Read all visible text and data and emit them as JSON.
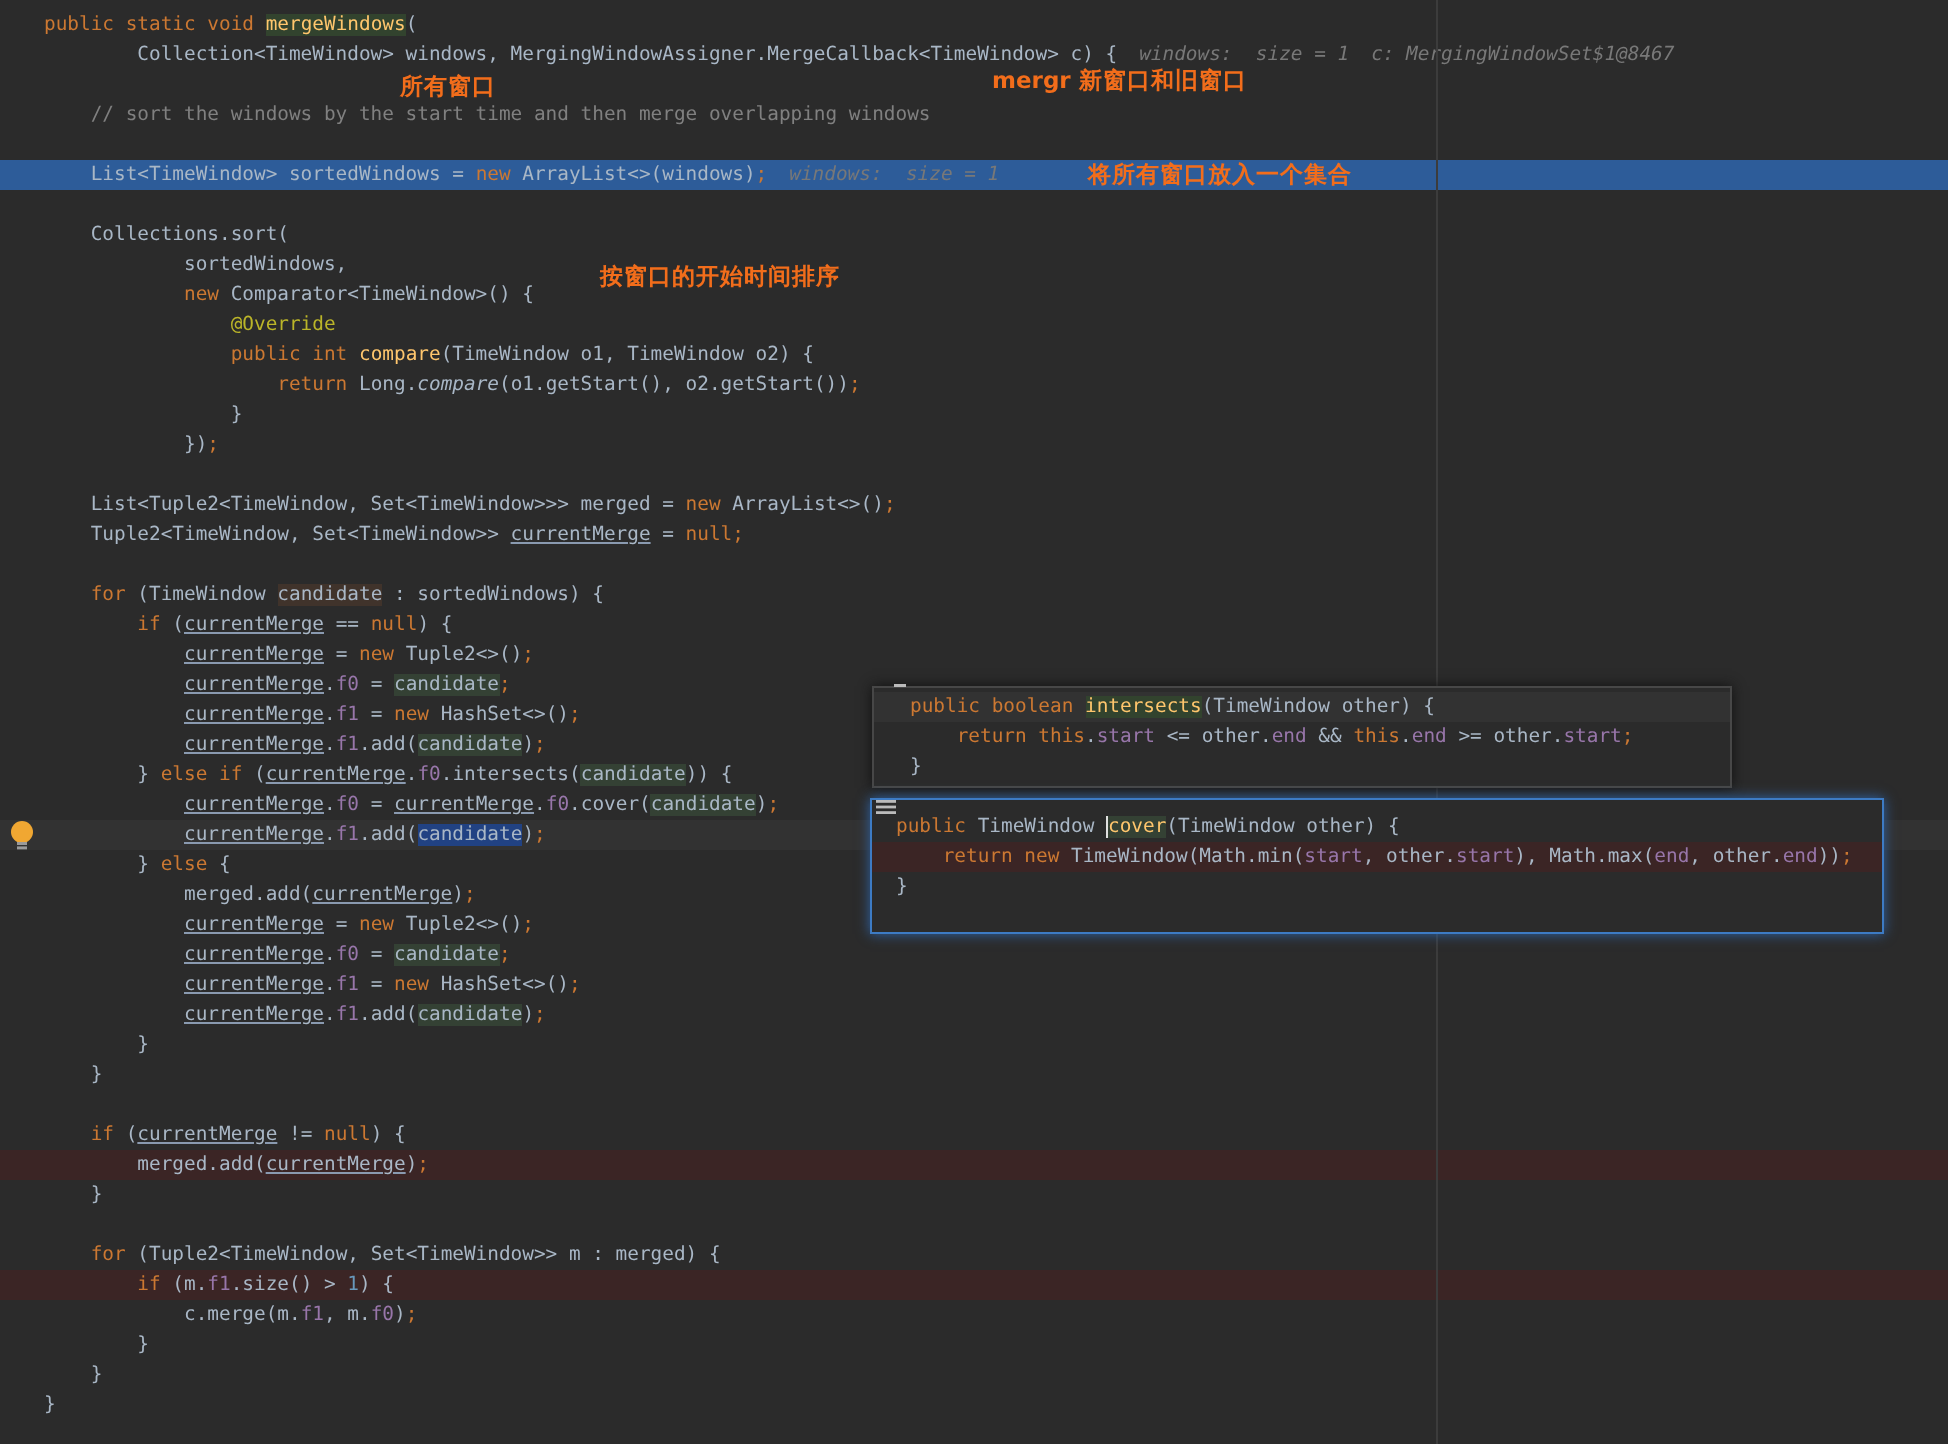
{
  "editor": {
    "lines": [
      {
        "kind": "code",
        "tokens": [
          {
            "text": "public static void ",
            "kind": "keyword"
          },
          {
            "text": "mergeWindows",
            "kind": "markedmethod"
          },
          {
            "text": "(",
            "kind": "plain"
          }
        ]
      },
      {
        "kind": "code",
        "tokens": [
          {
            "text": "        Collection<TimeWindow> windows, MergingWindowAssigner.MergeCallback<TimeWindow> c) {",
            "kind": "plain"
          },
          {
            "text": "windows:  size = 1",
            "kind": "hint"
          },
          {
            "text": "c: MergingWindowSet$1@8467",
            "kind": "hint"
          }
        ]
      },
      {
        "kind": "blank"
      },
      {
        "kind": "code",
        "tokens": [
          {
            "text": "    // sort the windows by the start time and then merge overlapping windows",
            "kind": "comment"
          }
        ]
      },
      {
        "kind": "blank"
      },
      {
        "kind": "execution",
        "tokens": [
          {
            "text": "    List<TimeWindow> sortedWindows = ",
            "kind": "plain"
          },
          {
            "text": "new",
            "kind": "keyword"
          },
          {
            "text": " ArrayList<>(windows)",
            "kind": "plain"
          },
          {
            "text": ";",
            "kind": "keyword"
          },
          {
            "text": "windows:  size = 1",
            "kind": "hint"
          }
        ]
      },
      {
        "kind": "blank"
      },
      {
        "kind": "code",
        "tokens": [
          {
            "text": "    Collections.sort(",
            "kind": "plain"
          }
        ]
      },
      {
        "kind": "code",
        "tokens": [
          {
            "text": "            sortedWindows,",
            "kind": "plain"
          }
        ]
      },
      {
        "kind": "code",
        "tokens": [
          {
            "text": "            new",
            "kind": "keyword"
          },
          {
            "text": " Comparator<TimeWindow>() {",
            "kind": "plain"
          }
        ]
      },
      {
        "kind": "code",
        "tokens": [
          {
            "text": "                @Override",
            "kind": "annotation"
          }
        ]
      },
      {
        "kind": "code",
        "tokens": [
          {
            "text": "                public int ",
            "kind": "keyword"
          },
          {
            "text": "compare",
            "kind": "method"
          },
          {
            "text": "(TimeWindow o1, TimeWindow o2) {",
            "kind": "plain"
          }
        ]
      },
      {
        "kind": "code",
        "tokens": [
          {
            "text": "                    return ",
            "kind": "keyword"
          },
          {
            "text": "Long.",
            "kind": "plain"
          },
          {
            "text": "compare",
            "kind": "italic"
          },
          {
            "text": "(o1.getStart(), o2.getStart())",
            "kind": "plain"
          },
          {
            "text": ";",
            "kind": "keyword"
          }
        ]
      },
      {
        "kind": "code",
        "tokens": [
          {
            "text": "                }",
            "kind": "plain"
          }
        ]
      },
      {
        "kind": "code",
        "tokens": [
          {
            "text": "            })",
            "kind": "plain"
          },
          {
            "text": ";",
            "kind": "keyword"
          }
        ]
      },
      {
        "kind": "blank"
      },
      {
        "kind": "code",
        "tokens": [
          {
            "text": "    List<Tuple2<TimeWindow, Set<TimeWindow>>> merged = ",
            "kind": "plain"
          },
          {
            "text": "new",
            "kind": "keyword"
          },
          {
            "text": " ArrayList<>()",
            "kind": "plain"
          },
          {
            "text": ";",
            "kind": "keyword"
          }
        ]
      },
      {
        "kind": "code",
        "tokens": [
          {
            "text": "    Tuple2<TimeWindow, Set<TimeWindow>> ",
            "kind": "plain"
          },
          {
            "text": "currentMerge",
            "kind": "variable"
          },
          {
            "text": " = ",
            "kind": "plain"
          },
          {
            "text": "null;",
            "kind": "keyword"
          }
        ]
      },
      {
        "kind": "blank"
      },
      {
        "kind": "code",
        "tokens": [
          {
            "text": "    for ",
            "kind": "keyword"
          },
          {
            "text": "(TimeWindow ",
            "kind": "plain"
          },
          {
            "text": "candidate",
            "kind": "writeref"
          },
          {
            "text": " : sortedWindows) {",
            "kind": "plain"
          }
        ]
      },
      {
        "kind": "code",
        "tokens": [
          {
            "text": "        if ",
            "kind": "keyword"
          },
          {
            "text": "(",
            "kind": "plain"
          },
          {
            "text": "currentMerge",
            "kind": "variable"
          },
          {
            "text": " == ",
            "kind": "plain"
          },
          {
            "text": "null",
            "kind": "keyword"
          },
          {
            "text": ") {",
            "kind": "plain"
          }
        ]
      },
      {
        "kind": "code",
        "tokens": [
          {
            "text": "            currentMerge",
            "kind": "variable"
          },
          {
            "text": " = ",
            "kind": "plain"
          },
          {
            "text": "new",
            "kind": "keyword"
          },
          {
            "text": " Tuple2<>()",
            "kind": "plain"
          },
          {
            "text": ";",
            "kind": "keyword"
          }
        ]
      },
      {
        "kind": "code",
        "tokens": [
          {
            "text": "            currentMerge",
            "kind": "variable"
          },
          {
            "text": ".",
            "kind": "plain"
          },
          {
            "text": "f0",
            "kind": "field"
          },
          {
            "text": " = ",
            "kind": "plain"
          },
          {
            "text": "candidate",
            "kind": "readref"
          },
          {
            "text": ";",
            "kind": "keyword"
          }
        ]
      },
      {
        "kind": "code",
        "tokens": [
          {
            "text": "            currentMerge",
            "kind": "variable"
          },
          {
            "text": ".",
            "kind": "plain"
          },
          {
            "text": "f1",
            "kind": "field"
          },
          {
            "text": " = ",
            "kind": "plain"
          },
          {
            "text": "new",
            "kind": "keyword"
          },
          {
            "text": " HashSet<>()",
            "kind": "plain"
          },
          {
            "text": ";",
            "kind": "keyword"
          }
        ]
      },
      {
        "kind": "code",
        "tokens": [
          {
            "text": "            currentMerge",
            "kind": "variable"
          },
          {
            "text": ".",
            "kind": "plain"
          },
          {
            "text": "f1",
            "kind": "field"
          },
          {
            "text": ".add(",
            "kind": "plain"
          },
          {
            "text": "candidate",
            "kind": "readref"
          },
          {
            "text": ")",
            "kind": "plain"
          },
          {
            "text": ";",
            "kind": "keyword"
          }
        ]
      },
      {
        "kind": "code",
        "tokens": [
          {
            "text": "        } ",
            "kind": "plain"
          },
          {
            "text": "else if ",
            "kind": "keyword"
          },
          {
            "text": "(",
            "kind": "plain"
          },
          {
            "text": "currentMerge",
            "kind": "variable"
          },
          {
            "text": ".",
            "kind": "plain"
          },
          {
            "text": "f0",
            "kind": "field"
          },
          {
            "text": ".intersects(",
            "kind": "plain"
          },
          {
            "text": "candidate",
            "kind": "readref"
          },
          {
            "text": ")) {",
            "kind": "plain"
          }
        ]
      },
      {
        "kind": "code",
        "tokens": [
          {
            "text": "            currentMerge",
            "kind": "variable"
          },
          {
            "text": ".",
            "kind": "plain"
          },
          {
            "text": "f0",
            "kind": "field"
          },
          {
            "text": " = ",
            "kind": "plain"
          },
          {
            "text": "currentMerge",
            "kind": "variable"
          },
          {
            "text": ".",
            "kind": "plain"
          },
          {
            "text": "f0",
            "kind": "field"
          },
          {
            "text": ".cover(",
            "kind": "plain"
          },
          {
            "text": "candidate",
            "kind": "readref"
          },
          {
            "text": ")",
            "kind": "plain"
          },
          {
            "text": ";",
            "kind": "keyword"
          }
        ]
      },
      {
        "kind": "intention",
        "tokens": [
          {
            "text": "            currentMerge",
            "kind": "variable"
          },
          {
            "text": ".",
            "kind": "plain"
          },
          {
            "text": "f1",
            "kind": "field"
          },
          {
            "text": ".add(",
            "kind": "plain"
          },
          {
            "text": "candidate",
            "kind": "selref"
          },
          {
            "text": ")",
            "kind": "plain"
          },
          {
            "text": ";",
            "kind": "keyword"
          }
        ]
      },
      {
        "kind": "code",
        "tokens": [
          {
            "text": "        } ",
            "kind": "plain"
          },
          {
            "text": "else",
            "kind": "keyword"
          },
          {
            "text": " {",
            "kind": "plain"
          }
        ]
      },
      {
        "kind": "code",
        "tokens": [
          {
            "text": "            merged.add(",
            "kind": "plain"
          },
          {
            "text": "currentMerge",
            "kind": "variable"
          },
          {
            "text": ")",
            "kind": "plain"
          },
          {
            "text": ";",
            "kind": "keyword"
          }
        ]
      },
      {
        "kind": "code",
        "tokens": [
          {
            "text": "            currentMerge",
            "kind": "variable"
          },
          {
            "text": " = ",
            "kind": "plain"
          },
          {
            "text": "new",
            "kind": "keyword"
          },
          {
            "text": " Tuple2<>()",
            "kind": "plain"
          },
          {
            "text": ";",
            "kind": "keyword"
          }
        ]
      },
      {
        "kind": "code",
        "tokens": [
          {
            "text": "            currentMerge",
            "kind": "variable"
          },
          {
            "text": ".",
            "kind": "plain"
          },
          {
            "text": "f0",
            "kind": "field"
          },
          {
            "text": " = ",
            "kind": "plain"
          },
          {
            "text": "candidate",
            "kind": "readref"
          },
          {
            "text": ";",
            "kind": "keyword"
          }
        ]
      },
      {
        "kind": "code",
        "tokens": [
          {
            "text": "            currentMerge",
            "kind": "variable"
          },
          {
            "text": ".",
            "kind": "plain"
          },
          {
            "text": "f1",
            "kind": "field"
          },
          {
            "text": " = ",
            "kind": "plain"
          },
          {
            "text": "new",
            "kind": "keyword"
          },
          {
            "text": " HashSet<>()",
            "kind": "plain"
          },
          {
            "text": ";",
            "kind": "keyword"
          }
        ]
      },
      {
        "kind": "code",
        "tokens": [
          {
            "text": "            currentMerge",
            "kind": "variable"
          },
          {
            "text": ".",
            "kind": "plain"
          },
          {
            "text": "f1",
            "kind": "field"
          },
          {
            "text": ".add(",
            "kind": "plain"
          },
          {
            "text": "candidate",
            "kind": "readref"
          },
          {
            "text": ")",
            "kind": "plain"
          },
          {
            "text": ";",
            "kind": "keyword"
          }
        ]
      },
      {
        "kind": "code",
        "tokens": [
          {
            "text": "        }",
            "kind": "plain"
          }
        ]
      },
      {
        "kind": "code",
        "tokens": [
          {
            "text": "    }",
            "kind": "plain"
          }
        ]
      },
      {
        "kind": "blank"
      },
      {
        "kind": "code",
        "tokens": [
          {
            "text": "    if ",
            "kind": "keyword"
          },
          {
            "text": "(",
            "kind": "plain"
          },
          {
            "text": "currentMerge",
            "kind": "variable"
          },
          {
            "text": " != ",
            "kind": "plain"
          },
          {
            "text": "null",
            "kind": "keyword"
          },
          {
            "text": ") {",
            "kind": "plain"
          }
        ]
      },
      {
        "kind": "error",
        "tokens": [
          {
            "text": "        merged.add(",
            "kind": "plain"
          },
          {
            "text": "currentMerge",
            "kind": "variable"
          },
          {
            "text": ")",
            "kind": "plain"
          },
          {
            "text": ";",
            "kind": "keyword"
          }
        ]
      },
      {
        "kind": "code",
        "tokens": [
          {
            "text": "    }",
            "kind": "plain"
          }
        ]
      },
      {
        "kind": "blank"
      },
      {
        "kind": "code",
        "tokens": [
          {
            "text": "    for ",
            "kind": "keyword"
          },
          {
            "text": "(Tuple2<TimeWindow, Set<TimeWindow>> m : merged) {",
            "kind": "plain"
          }
        ]
      },
      {
        "kind": "error",
        "tokens": [
          {
            "text": "        if ",
            "kind": "keyword"
          },
          {
            "text": "(m.",
            "kind": "plain"
          },
          {
            "text": "f1",
            "kind": "field"
          },
          {
            "text": ".size() > ",
            "kind": "plain"
          },
          {
            "text": "1",
            "kind": "number"
          },
          {
            "text": ") {",
            "kind": "plain"
          }
        ]
      },
      {
        "kind": "code",
        "tokens": [
          {
            "text": "            c.merge(m.",
            "kind": "plain"
          },
          {
            "text": "f1",
            "kind": "field"
          },
          {
            "text": ", m.",
            "kind": "plain"
          },
          {
            "text": "f0",
            "kind": "field"
          },
          {
            "text": ")",
            "kind": "plain"
          },
          {
            "text": ";",
            "kind": "keyword"
          }
        ]
      },
      {
        "kind": "code",
        "tokens": [
          {
            "text": "        }",
            "kind": "plain"
          }
        ]
      },
      {
        "kind": "code",
        "tokens": [
          {
            "text": "    }",
            "kind": "plain"
          }
        ]
      },
      {
        "kind": "code",
        "tokens": [
          {
            "text": "}",
            "kind": "plain"
          }
        ]
      }
    ]
  },
  "notes": [
    {
      "text": "所有窗口"
    },
    {
      "text": "mergr 新窗口和旧窗口"
    },
    {
      "text": "将所有窗口放入一个集合"
    },
    {
      "text": "按窗口的开始时间排序"
    }
  ],
  "popups": [
    {
      "kind": "plain",
      "lines": [
        {
          "kind": "caret",
          "tokens": [
            {
              "text": "public boolean ",
              "kind": "keyword"
            },
            {
              "text": "intersects",
              "kind": "markedmethod"
            },
            {
              "text": "(TimeWindow other) {",
              "kind": "plain"
            }
          ]
        },
        {
          "kind": "code",
          "tokens": [
            {
              "text": "    return this",
              "kind": "keyword"
            },
            {
              "text": ".",
              "kind": "plain"
            },
            {
              "text": "start",
              "kind": "field"
            },
            {
              "text": " <= other.",
              "kind": "plain"
            },
            {
              "text": "end",
              "kind": "field"
            },
            {
              "text": " && ",
              "kind": "plain"
            },
            {
              "text": "this",
              "kind": "keyword"
            },
            {
              "text": ".",
              "kind": "plain"
            },
            {
              "text": "end",
              "kind": "field"
            },
            {
              "text": " >= other.",
              "kind": "plain"
            },
            {
              "text": "start",
              "kind": "field"
            },
            {
              "text": ";",
              "kind": "keyword"
            }
          ]
        },
        {
          "kind": "code",
          "tokens": [
            {
              "text": "}",
              "kind": "plain"
            }
          ]
        }
      ]
    },
    {
      "kind": "focused",
      "lines": [
        {
          "kind": "code",
          "tokens": [
            {
              "text": "public ",
              "kind": "keyword"
            },
            {
              "text": "TimeWindow ",
              "kind": "plain"
            },
            {
              "text": "cover",
              "kind": "cursormethod"
            },
            {
              "text": "(TimeWindow other) {",
              "kind": "plain"
            }
          ]
        },
        {
          "kind": "error",
          "tokens": [
            {
              "text": "    return new ",
              "kind": "keyword"
            },
            {
              "text": "TimeWindow(Math.min(",
              "kind": "plain"
            },
            {
              "text": "start",
              "kind": "field"
            },
            {
              "text": ", other.",
              "kind": "plain"
            },
            {
              "text": "start",
              "kind": "field"
            },
            {
              "text": "), Math.max(",
              "kind": "plain"
            },
            {
              "text": "end",
              "kind": "field"
            },
            {
              "text": ", other.",
              "kind": "plain"
            },
            {
              "text": "end",
              "kind": "field"
            },
            {
              "text": "))",
              "kind": "plain"
            },
            {
              "text": ";",
              "kind": "keyword"
            }
          ]
        },
        {
          "kind": "code",
          "tokens": [
            {
              "text": "}",
              "kind": "plain"
            }
          ]
        }
      ]
    }
  ]
}
